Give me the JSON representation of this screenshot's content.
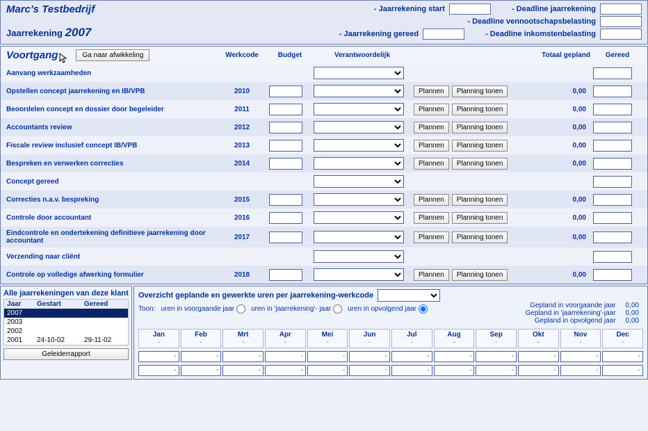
{
  "header": {
    "company": "Marc's Testbedrijf",
    "subline_label": "Jaarrekening",
    "year": "2007",
    "fields": {
      "start": "- Jaarrekening start",
      "deadline_jr": "- Deadline jaarrekening",
      "venn": "- Deadline vennootschapsbelasting",
      "gereed": "- Jaarrekening gereed",
      "inkom": "- Deadline inkomstenbelasting"
    }
  },
  "progress": {
    "title": "Voortgang",
    "goto_btn": "Ga naar afwikkeling",
    "cols": {
      "werkcode": "Werkcode",
      "budget": "Budget",
      "verantw": "Verantwoordelijk",
      "totaal": "Totaal gepland",
      "gereed": "Gereed"
    },
    "plannen_label": "Plannen",
    "tonen_label": "Planning tonen",
    "rows": [
      {
        "name": "Aanvang werkzaamheden",
        "werkcode": "",
        "budget": false,
        "resp": true,
        "actions": false,
        "totaal": "",
        "gereed": true
      },
      {
        "name": "Opstellen concept jaarrekening en IB/VPB",
        "werkcode": "2010",
        "budget": true,
        "resp": true,
        "actions": true,
        "totaal": "0,00",
        "gereed": true
      },
      {
        "name": "Beoordelen concept en dossier door begeleider",
        "werkcode": "2011",
        "budget": true,
        "resp": true,
        "actions": true,
        "totaal": "0,00",
        "gereed": true
      },
      {
        "name": "Accountants review",
        "werkcode": "2012",
        "budget": true,
        "resp": true,
        "actions": true,
        "totaal": "0,00",
        "gereed": true
      },
      {
        "name": "Fiscale review inclusief concept IB/VPB",
        "werkcode": "2013",
        "budget": true,
        "resp": true,
        "actions": true,
        "totaal": "0,00",
        "gereed": true
      },
      {
        "name": "Bespreken en verwerken correcties",
        "werkcode": "2014",
        "budget": true,
        "resp": true,
        "actions": true,
        "totaal": "0,00",
        "gereed": true
      },
      {
        "name": "Concept gereed",
        "werkcode": "",
        "budget": false,
        "resp": true,
        "actions": false,
        "totaal": "",
        "gereed": true
      },
      {
        "name": "Correcties n.a.v. bespreking",
        "werkcode": "2015",
        "budget": true,
        "resp": true,
        "actions": true,
        "totaal": "0,00",
        "gereed": true
      },
      {
        "name": "Controle door accountant",
        "werkcode": "2016",
        "budget": true,
        "resp": true,
        "actions": true,
        "totaal": "0,00",
        "gereed": true
      },
      {
        "name": "Eindcontrole en ondertekening definitieve jaarrekening door accountant",
        "werkcode": "2017",
        "budget": true,
        "resp": true,
        "actions": true,
        "totaal": "0,00",
        "gereed": true
      },
      {
        "name": "Verzending naar cliënt",
        "werkcode": "",
        "budget": false,
        "resp": true,
        "actions": false,
        "totaal": "",
        "gereed": true
      },
      {
        "name": "Controle op volledige afwerking formulier",
        "werkcode": "2018",
        "budget": true,
        "resp": true,
        "actions": true,
        "totaal": "0,00",
        "gereed": true
      }
    ]
  },
  "left": {
    "title": "Alle jaarrekeningen van deze klant",
    "cols": {
      "jaar": "Jaar",
      "gestart": "Gestart",
      "gereed": "Gereed"
    },
    "years": [
      {
        "jaar": "2007",
        "gestart": "",
        "gereed": "",
        "sel": true
      },
      {
        "jaar": "2003",
        "gestart": "",
        "gereed": ""
      },
      {
        "jaar": "2002",
        "gestart": "",
        "gereed": ""
      },
      {
        "jaar": "2001",
        "gestart": "24-10-02",
        "gereed": "29-11-02"
      }
    ],
    "btn": "Geleiderrapport"
  },
  "right": {
    "title": "Overzicht geplande en gewerkte uren per jaarrekening-werkcode",
    "toon_label": "Toon:",
    "opts": {
      "voor": "uren in voorgaande jaar",
      "jr": "uren in 'jaarrekening'- jaar",
      "opv": "uren in opvolgend jaar"
    },
    "gepland": {
      "voor": "Gepland in voorgaande jaar",
      "jr": "Gepland in 'jaarrekening'-jaar",
      "opv": "Gepland in opvolgend jaar",
      "val": "0,00"
    },
    "months": [
      "Jan",
      "Feb",
      "Mrt",
      "Apr",
      "Mei",
      "Jun",
      "Jul",
      "Aug",
      "Sep",
      "Okt",
      "Nov",
      "Dec"
    ]
  }
}
